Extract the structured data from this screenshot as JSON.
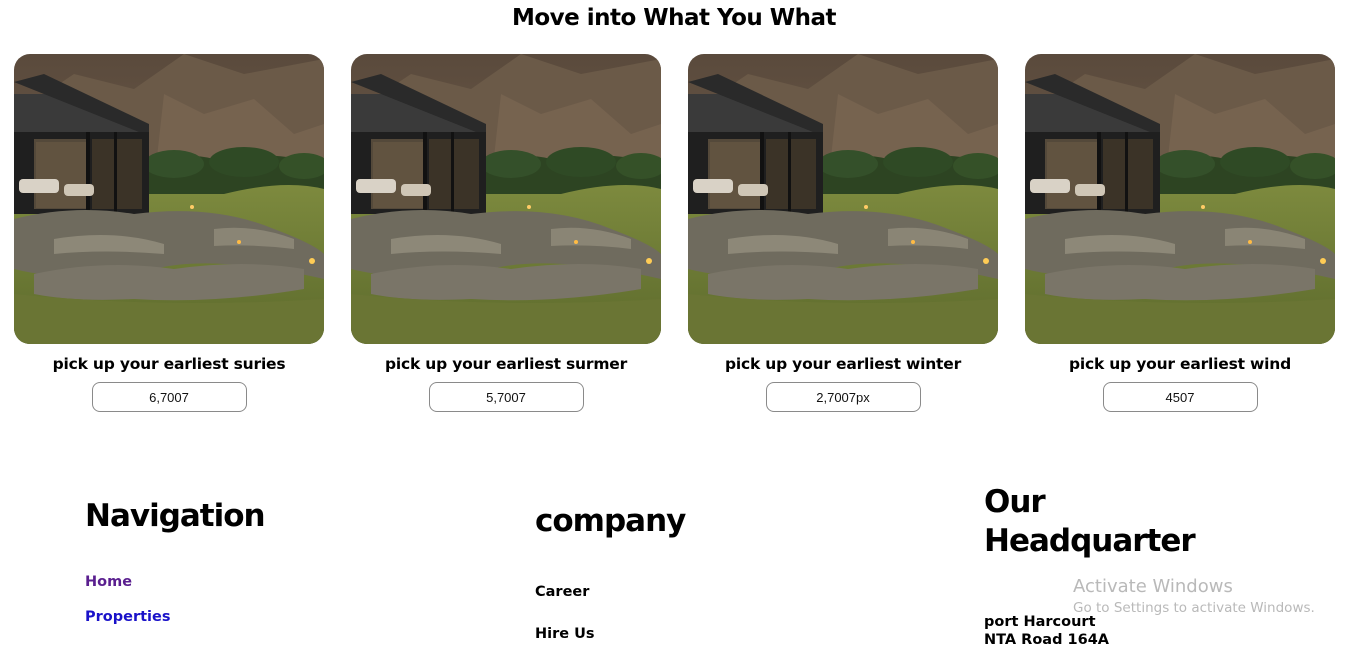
{
  "page_title": "Move into What You What",
  "cards": [
    {
      "caption": "pick up your earliest suries",
      "value": "6,7007"
    },
    {
      "caption": "pick up your earliest surmer",
      "value": "5,7007"
    },
    {
      "caption": "pick up your earliest winter",
      "value": "2,7007px"
    },
    {
      "caption": "pick up your earliest wind",
      "value": "4507"
    }
  ],
  "footer": {
    "navigation": {
      "heading": "Navigation",
      "links": [
        "Home",
        "Properties"
      ],
      "link_colors": [
        "#5a1f8f",
        "#1a12c9"
      ]
    },
    "company": {
      "heading": "company",
      "links": [
        "Career",
        "Hire Us"
      ]
    },
    "headquarter": {
      "heading_line1": "Our",
      "heading_line2": "Headquarter",
      "address_line1": "port Harcourt",
      "address_line2": "NTA Road 164A"
    }
  },
  "watermark": {
    "line1": "Activate Windows",
    "line2": "Go to Settings to activate Windows."
  }
}
